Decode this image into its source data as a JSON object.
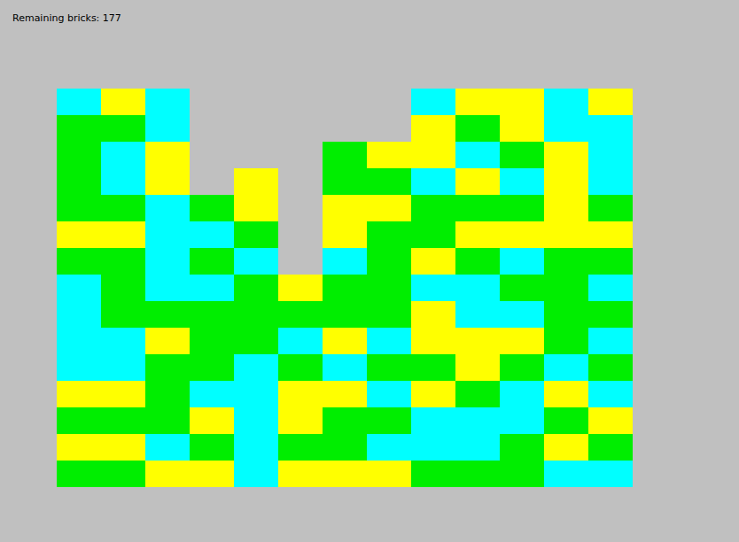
{
  "status": {
    "remaining": "Remaining bricks: 177"
  },
  "grid": {
    "rows": [
      [
        "#00ffff",
        "#ffff00",
        "#00ffff",
        null,
        null,
        null,
        null,
        null,
        "#00ffff",
        "#ffff00",
        "#ffff00",
        "#00ffff",
        "#ffff00"
      ],
      [
        "#00ee00",
        "#00ee00",
        "#00ffff",
        null,
        null,
        null,
        null,
        null,
        "#ffff00",
        "#00ee00",
        "#ffff00",
        "#00ffff",
        "#00ffff"
      ],
      [
        "#00ee00",
        "#00ffff",
        "#ffff00",
        null,
        null,
        null,
        "#00ee00",
        "#ffff00",
        "#ffff00",
        "#00ffff",
        "#00ee00",
        "#ffff00",
        "#00ffff"
      ],
      [
        "#00ee00",
        "#00ffff",
        "#ffff00",
        null,
        "#ffff00",
        null,
        "#00ee00",
        "#00ee00",
        "#00ffff",
        "#ffff00",
        "#00ffff",
        "#ffff00",
        "#00ffff"
      ],
      [
        "#00ee00",
        "#00ee00",
        "#00ffff",
        "#00ee00",
        "#ffff00",
        null,
        "#ffff00",
        "#ffff00",
        "#00ee00",
        "#00ee00",
        "#00ee00",
        "#ffff00",
        "#00ee00"
      ],
      [
        "#ffff00",
        "#ffff00",
        "#00ffff",
        "#00ffff",
        "#00ee00",
        null,
        "#ffff00",
        "#00ee00",
        "#00ee00",
        "#ffff00",
        "#ffff00",
        "#ffff00",
        "#ffff00"
      ],
      [
        "#00ee00",
        "#00ee00",
        "#00ffff",
        "#00ee00",
        "#00ffff",
        null,
        "#00ffff",
        "#00ee00",
        "#ffff00",
        "#00ee00",
        "#00ffff",
        "#00ee00",
        "#00ee00"
      ],
      [
        "#00ffff",
        "#00ee00",
        "#00ffff",
        "#00ffff",
        "#00ee00",
        "#ffff00",
        "#00ee00",
        "#00ee00",
        "#00ffff",
        "#00ffff",
        "#00ee00",
        "#00ee00",
        "#00ffff"
      ],
      [
        "#00ffff",
        "#00ee00",
        "#00ee00",
        "#00ee00",
        "#00ee00",
        "#00ee00",
        "#00ee00",
        "#00ee00",
        "#ffff00",
        "#00ffff",
        "#00ffff",
        "#00ee00",
        "#00ee00"
      ],
      [
        "#00ffff",
        "#00ffff",
        "#ffff00",
        "#00ee00",
        "#00ee00",
        "#00ffff",
        "#ffff00",
        "#00ffff",
        "#ffff00",
        "#ffff00",
        "#ffff00",
        "#00ee00",
        "#00ffff"
      ],
      [
        "#00ffff",
        "#00ffff",
        "#00ee00",
        "#00ee00",
        "#00ffff",
        "#00ee00",
        "#00ffff",
        "#00ee00",
        "#00ee00",
        "#ffff00",
        "#00ee00",
        "#00ffff",
        "#00ee00"
      ],
      [
        "#ffff00",
        "#ffff00",
        "#00ee00",
        "#00ffff",
        "#00ffff",
        "#ffff00",
        "#ffff00",
        "#00ffff",
        "#ffff00",
        "#00ee00",
        "#00ffff",
        "#ffff00",
        "#00ffff"
      ],
      [
        "#00ee00",
        "#00ee00",
        "#00ee00",
        "#ffff00",
        "#00ffff",
        "#ffff00",
        "#00ee00",
        "#00ee00",
        "#00ffff",
        "#00ffff",
        "#00ffff",
        "#00ee00",
        "#ffff00"
      ],
      [
        "#ffff00",
        "#ffff00",
        "#00ffff",
        "#00ee00",
        "#00ffff",
        "#00ee00",
        "#00ee00",
        "#00ffff",
        "#00ffff",
        "#00ffff",
        "#00ee00",
        "#ffff00",
        "#00ee00"
      ],
      [
        "#00ee00",
        "#00ee00",
        "#ffff00",
        "#ffff00",
        "#00ffff",
        "#ffff00",
        "#ffff00",
        "#ffff00",
        "#00ee00",
        "#00ee00",
        "#00ee00",
        "#00ffff",
        "#00ffff"
      ]
    ]
  }
}
